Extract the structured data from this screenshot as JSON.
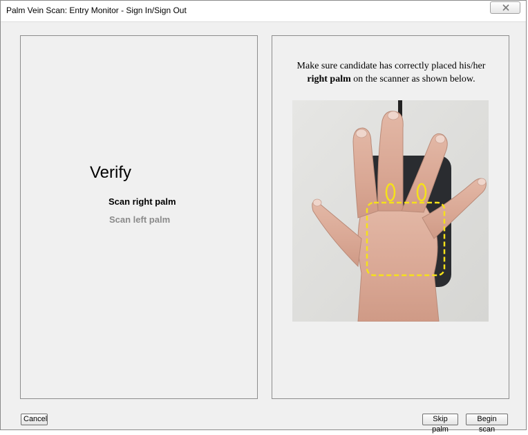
{
  "window": {
    "title": "Palm Vein Scan: Entry Monitor - Sign In/Sign Out",
    "close_icon": "close-icon"
  },
  "left_panel": {
    "heading": "Verify",
    "steps": [
      {
        "label": "Scan right palm",
        "state": "current"
      },
      {
        "label": "Scan left palm",
        "state": "pending"
      }
    ]
  },
  "right_panel": {
    "instruction_pre": "Make sure candidate has correctly placed his/her",
    "instruction_bold": "right palm",
    "instruction_post": "on the scanner as shown below.",
    "image": "right-hand-on-palm-scanner",
    "guide_color": "#f5e11a"
  },
  "buttons": {
    "cancel": "Cancel",
    "skip": "Skip palm",
    "begin": "Begin scan"
  }
}
